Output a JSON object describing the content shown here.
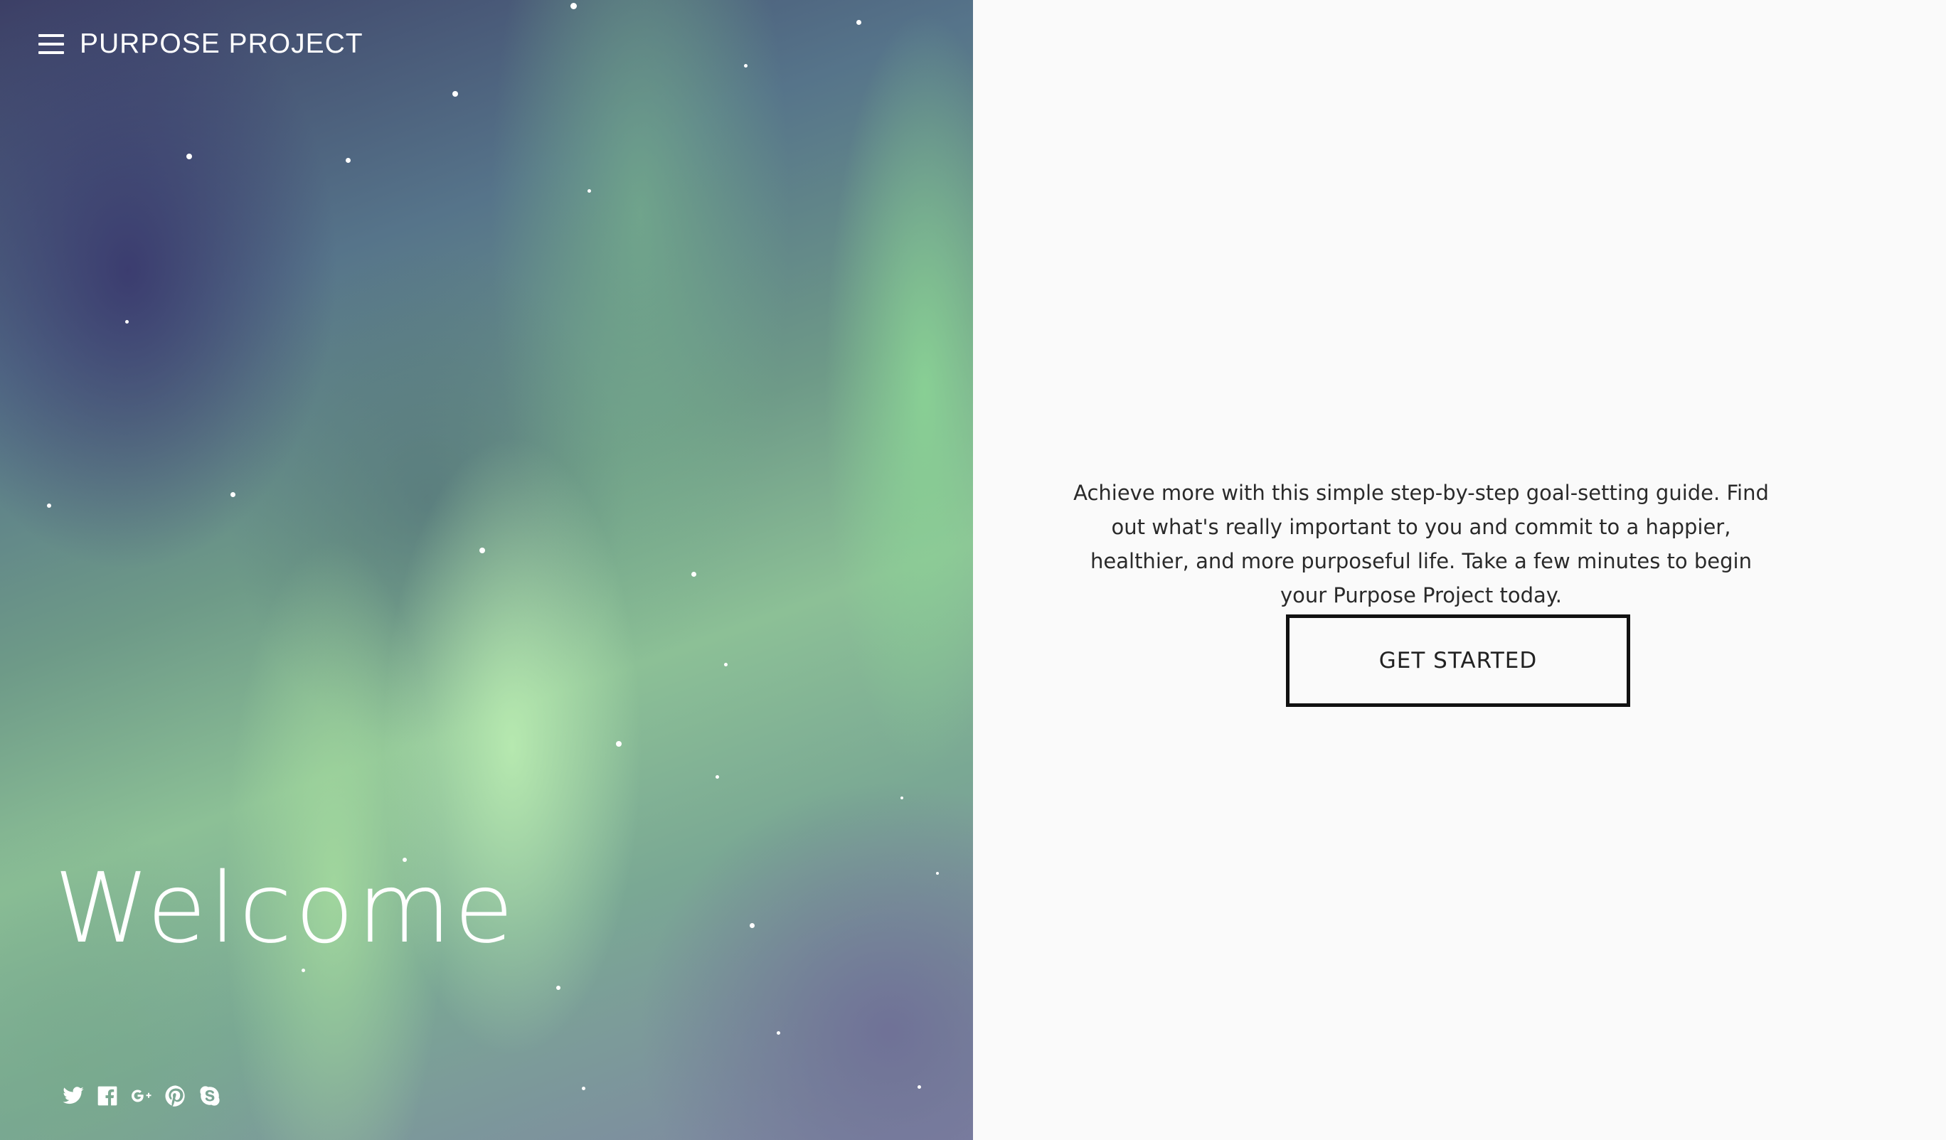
{
  "brand": {
    "title": "PURPOSE PROJECT",
    "menu_icon": "hamburger-menu-icon"
  },
  "hero": {
    "heading": "Welcome"
  },
  "social": [
    {
      "name": "twitter-icon"
    },
    {
      "name": "facebook-icon"
    },
    {
      "name": "google-plus-icon"
    },
    {
      "name": "pinterest-icon"
    },
    {
      "name": "skype-icon"
    }
  ],
  "main": {
    "description": "Achieve more with this simple step-by-step goal-setting guide. Find out what's really important to you and commit to a happier, healthier, and more purposeful life. Take a few minutes to begin your Purpose Project today.",
    "cta_label": "GET STARTED"
  },
  "colors": {
    "text_dark": "#2a2a2a",
    "button_border": "#111111",
    "panel_bg": "#fafafa",
    "hero_text": "#ffffff"
  }
}
